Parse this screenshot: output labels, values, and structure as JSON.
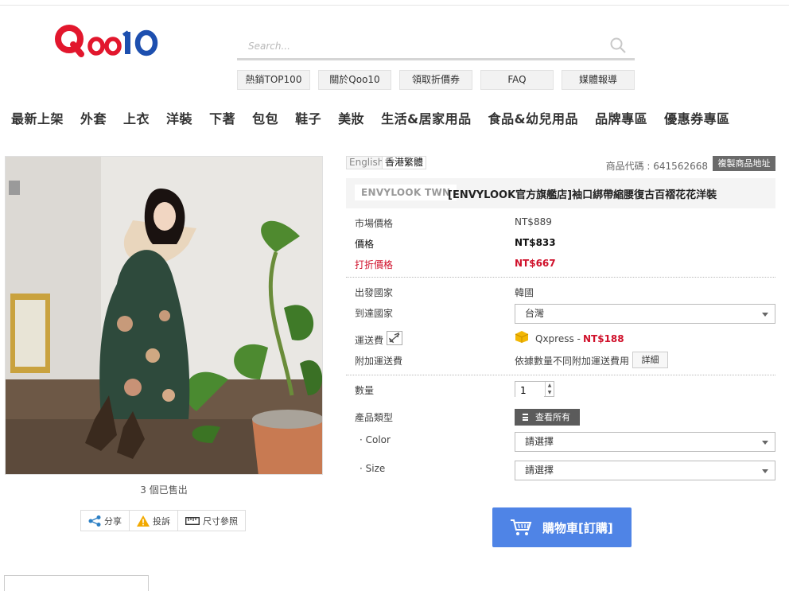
{
  "colors": {
    "brand_red": "#e2172d",
    "brand_blue": "#1d4faf",
    "cart_blue": "#4f84e6",
    "price_red": "#d0112b"
  },
  "header": {
    "logo_text": "Qoo10",
    "search_placeholder": "Search...",
    "quick_links": [
      "熱銷TOP100",
      "關於Qoo10",
      "領取折價券",
      "FAQ",
      "媒體報導"
    ]
  },
  "categories": [
    "最新上架",
    "外套",
    "上衣",
    "洋裝",
    "下著",
    "包包",
    "鞋子",
    "美妝",
    "生活&居家用品",
    "食品&幼兒用品",
    "品牌專區",
    "優惠券專區"
  ],
  "gallery": {
    "sold_text": "3 個已售出",
    "actions": {
      "share": "分享",
      "report": "投訴",
      "size": "尺寸參照"
    }
  },
  "product": {
    "lang_en": "English",
    "lang_hk": "香港繁體",
    "code_text": "商品代碼 : 641562668",
    "copy_button": "複製商品地址",
    "seller": "ENVYLOOK TWN",
    "title": "[ENVYLOOK官方旗艦店]袖口綁帶縮腰復古百褶花花洋裝",
    "market_price_label": "市場價格",
    "market_price": "NT$889",
    "price_label": "價格",
    "price": "NT$833",
    "discount_label": "打折價格",
    "discount_price": "NT$667",
    "origin_label": "出發國家",
    "origin": "韓國",
    "dest_label": "到達國家",
    "dest": "台灣",
    "shipping_label": "運送費",
    "shipping_carrier": "Qxpress -",
    "shipping_fee": "NT$188",
    "extra_label": "附加運送費",
    "extra_text": "依據數量不同附加運送費用",
    "detail_button": "詳細",
    "qty_label": "數量",
    "qty_value": "1",
    "type_label": "產品類型",
    "view_all": "查看所有",
    "color_label": "· Color",
    "size_label": "· Size",
    "select_placeholder": "請選擇",
    "cart_button": "購物車[訂購]"
  }
}
